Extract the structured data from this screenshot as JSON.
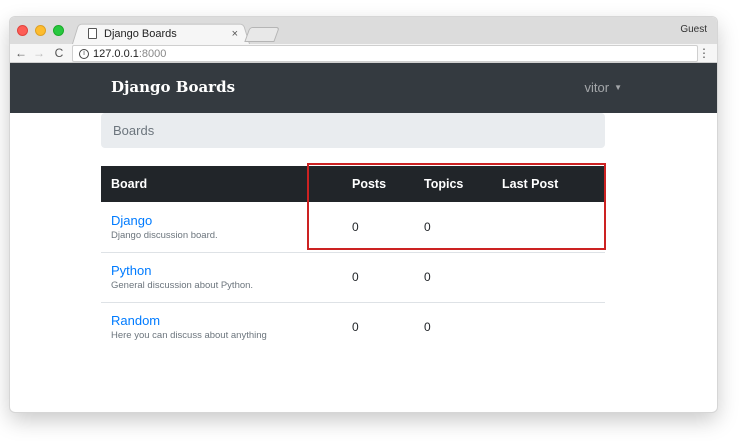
{
  "browser": {
    "tab_title": "Django Boards",
    "tab_close": "×",
    "profile": "Guest",
    "url_host": "127.0.0.1",
    "url_port": ":8000",
    "back": "←",
    "forward": "→",
    "reload": "C",
    "menu": "⋮",
    "info": "i"
  },
  "navbar": {
    "brand": "Django Boards",
    "user": "vitor",
    "caret": "▼"
  },
  "breadcrumb": {
    "current": "Boards"
  },
  "table": {
    "headers": [
      "Board",
      "Posts",
      "Topics",
      "Last Post"
    ],
    "rows": [
      {
        "name": "Django",
        "description": "Django discussion board.",
        "posts": "0",
        "topics": "0",
        "last_post": ""
      },
      {
        "name": "Python",
        "description": "General discussion about Python.",
        "posts": "0",
        "topics": "0",
        "last_post": ""
      },
      {
        "name": "Random",
        "description": "Here you can discuss about anything",
        "posts": "0",
        "topics": "0",
        "last_post": ""
      }
    ]
  },
  "colors": {
    "navbar": "#343a40",
    "table_header": "#212529",
    "link": "#007bff",
    "highlight": "#cc2222"
  }
}
